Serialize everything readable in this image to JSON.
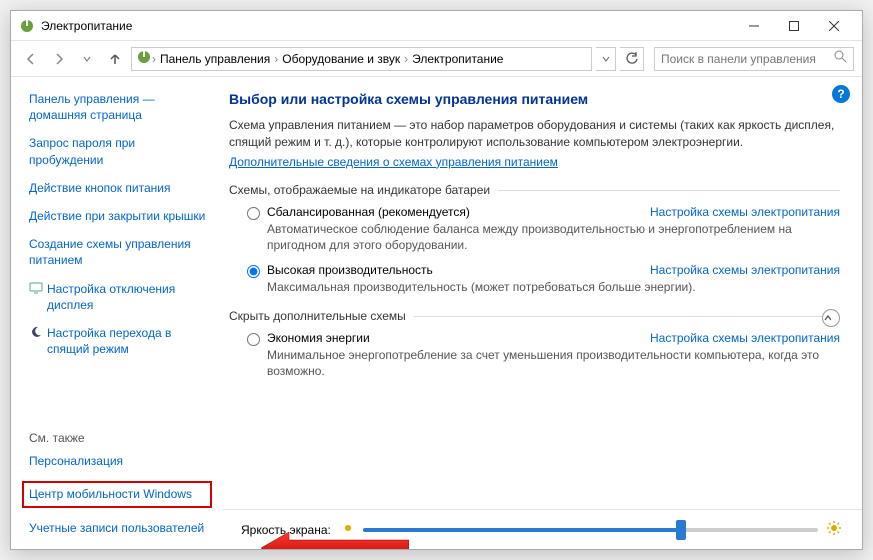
{
  "window": {
    "title": "Электропитание"
  },
  "breadcrumb": {
    "items": [
      "Панель управления",
      "Оборудование и звук",
      "Электропитание"
    ]
  },
  "search": {
    "placeholder": "Поиск в панели управления"
  },
  "sidebar": {
    "home": "Панель управления — домашняя страница",
    "items": [
      "Запрос пароля при пробуждении",
      "Действие кнопок питания",
      "Действие при закрытии крышки",
      "Создание схемы управления питанием",
      "Настройка отключения дисплея",
      "Настройка перехода в спящий режим"
    ],
    "see_also_heading": "См. также",
    "see_also": [
      "Персонализация",
      "Центр мобильности Windows",
      "Учетные записи пользователей"
    ]
  },
  "main": {
    "heading": "Выбор или настройка схемы управления питанием",
    "intro": "Схема управления питанием — это набор параметров оборудования и системы (таких как яркость дисплея, спящий режим и т. д.), которые контролируют использование компьютером электроэнергии.",
    "learn_more": "Дополнительные сведения о схемах управления питанием",
    "section1": "Схемы, отображаемые на индикаторе батареи",
    "plans": [
      {
        "name": "Сбалансированная (рекомендуется)",
        "cfg": "Настройка схемы электропитания",
        "desc": "Автоматическое соблюдение баланса между производительностью и энергопотреблением на пригодном для этого оборудовании.",
        "selected": false
      },
      {
        "name": "Высокая производительность",
        "cfg": "Настройка схемы электропитания",
        "desc": "Максимальная производительность (может потребоваться больше энергии).",
        "selected": true
      }
    ],
    "section2": "Скрыть дополнительные схемы",
    "extra_plans": [
      {
        "name": "Экономия энергии",
        "cfg": "Настройка схемы электропитания",
        "desc": "Минимальное энергопотребление за счет уменьшения производительности компьютера, когда это возможно.",
        "selected": false
      }
    ],
    "brightness_label": "Яркость экрана:"
  }
}
